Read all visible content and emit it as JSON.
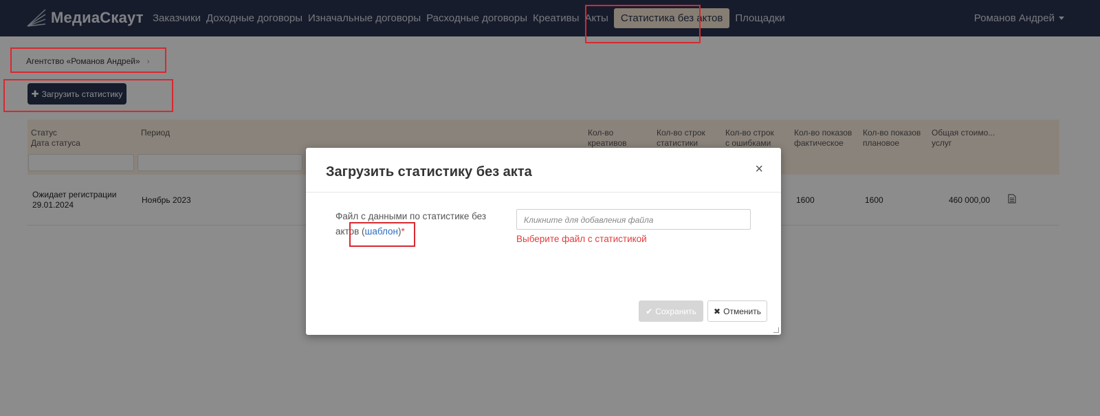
{
  "navbar": {
    "brand": "МедиаСкаут",
    "items": [
      {
        "label": "Заказчики"
      },
      {
        "label": "Доходные договоры"
      },
      {
        "label": "Изначальные договоры"
      },
      {
        "label": "Расходные договоры"
      },
      {
        "label": "Креативы"
      },
      {
        "label": "Акты"
      },
      {
        "label": "Статистика без актов"
      },
      {
        "label": "Площадки"
      }
    ],
    "active_index": 6,
    "user": "Романов Андрей"
  },
  "breadcrumb": {
    "item": "Агентство «Романов Андрей»",
    "separator": "›"
  },
  "upload_button": {
    "label": "Загрузить статистику",
    "icon": "plus-icon"
  },
  "table": {
    "headers": {
      "status": [
        "Статус",
        "Дата статуса"
      ],
      "period": "Период",
      "creatives": [
        "Кол-во",
        "креативов"
      ],
      "rows_count": [
        "Кол-во строк",
        "статистики"
      ],
      "rows_errors": [
        "Кол-во строк",
        "с ошибками"
      ],
      "impressions_fact": [
        "Кол-во показов",
        "фактическое"
      ],
      "impressions_plan": [
        "Кол-во показов",
        "плановое"
      ],
      "total_cost": [
        "Общая стоимо...",
        "услуг"
      ]
    },
    "rows": [
      {
        "status": "Ожидает регистрации",
        "status_date": "29.01.2024",
        "period": "Ноябрь 2023",
        "impressions_fact": "1600",
        "impressions_plan": "1600",
        "total_cost": "460 000,00",
        "doc_icon": "document-icon"
      }
    ]
  },
  "modal": {
    "title": "Загрузить статистику без акта",
    "close": "×",
    "field_label_prefix": "Файл с данными по статистике без актов (",
    "template_link": "шаблон",
    "field_label_suffix": ")",
    "required_mark": "*",
    "file_placeholder": "Кликните для добавления файла",
    "error": "Выберите файл с статистикой",
    "save_label": "Сохранить",
    "cancel_label": "Отменить"
  },
  "colors": {
    "navbar_bg": "#2a3450",
    "active_tab_bg": "#f4e5d2",
    "table_header_bg": "#fbeee0",
    "error": "#e23b3b",
    "link": "#2b6cc4",
    "annotation": "#d8282f"
  }
}
